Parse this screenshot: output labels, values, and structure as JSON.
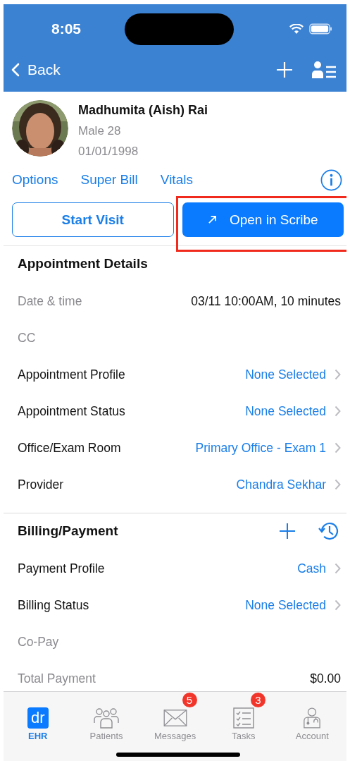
{
  "status_bar": {
    "time": "8:05"
  },
  "nav": {
    "back": "Back"
  },
  "patient": {
    "name": "Madhumita (Aish) Rai",
    "sex_age": "Male 28",
    "dob": "01/01/1998"
  },
  "links": [
    "Options",
    "Super Bill",
    "Vitals"
  ],
  "buttons": [
    {
      "label": "Start Visit",
      "kind": "outline"
    },
    {
      "label": "Open in Scribe",
      "kind": "primary",
      "highlighted": true
    }
  ],
  "sections": [
    {
      "title": "Appointment Details",
      "rows": [
        {
          "label": "Date & time",
          "value": "03/11 10:00AM, 10 minutes",
          "kind": "readonly"
        },
        {
          "label": "CC",
          "kind": "readonly"
        },
        {
          "label": "Appointment Profile",
          "value": "None Selected",
          "kind": "select"
        },
        {
          "label": "Appointment Status",
          "value": "None Selected",
          "kind": "select"
        },
        {
          "label": "Office/Exam Room",
          "value": "Primary Office - Exam 1",
          "kind": "select"
        },
        {
          "label": "Provider",
          "value": "Chandra Sekhar",
          "kind": "select"
        }
      ]
    },
    {
      "title": "Billing/Payment",
      "actions": [
        {
          "kind": "add"
        },
        {
          "kind": "history"
        }
      ],
      "rows": [
        {
          "label": "Payment Profile",
          "value": "Cash",
          "kind": "select"
        },
        {
          "label": "Billing Status",
          "value": "None Selected",
          "kind": "select"
        },
        {
          "label": "Co-Pay",
          "kind": "readonly"
        },
        {
          "label": "Total Payment",
          "value": "$0.00",
          "kind": "readonly"
        }
      ]
    }
  ],
  "tab_bar": [
    {
      "label": "EHR",
      "kind": "ehr",
      "icon_text": "dr",
      "selected": true
    },
    {
      "label": "Patients",
      "kind": "patients",
      "selected": false
    },
    {
      "label": "Messages",
      "kind": "messages",
      "badge": "5",
      "selected": false
    },
    {
      "label": "Tasks",
      "kind": "tasks",
      "badge": "3",
      "selected": false
    },
    {
      "label": "Account",
      "kind": "account",
      "selected": false
    }
  ]
}
